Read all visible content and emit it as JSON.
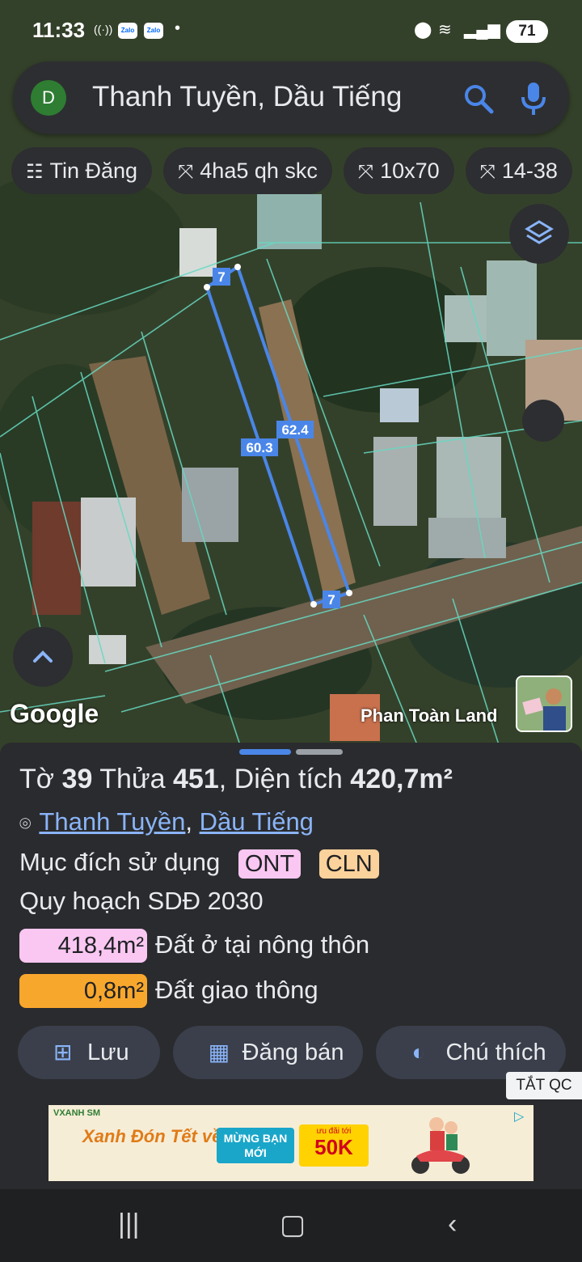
{
  "status_bar": {
    "time": "11:33",
    "battery": "71",
    "app_badges": [
      "Zalo",
      "Zalo"
    ]
  },
  "search": {
    "avatar_letter": "D",
    "query": "Thanh Tuyền, Dầu Tiếng"
  },
  "chips": [
    {
      "icon": "listing-icon",
      "label": "Tin Đăng"
    },
    {
      "icon": "measure-icon",
      "label": "4ha5 qh skc"
    },
    {
      "icon": "measure-icon",
      "label": "10x70"
    },
    {
      "icon": "measure-icon",
      "label": "14-38"
    }
  ],
  "map": {
    "side_labels": {
      "top": "7",
      "left": "60.3",
      "right": "62.4",
      "bottom": "7"
    },
    "attribution": "Phan Toàn Land",
    "logo": "Google"
  },
  "parcel": {
    "to_label": "Tờ",
    "to_value": "39",
    "thua_label": "Thửa",
    "thua_value": "451",
    "area_label": "Diện tích",
    "area_value": "420,7m²",
    "location_commune": "Thanh Tuyền",
    "location_district": "Dầu Tiếng",
    "purpose_label": "Mục đích sử dụng",
    "purpose_tags": [
      {
        "code": "ONT",
        "color": "#f9c7f2"
      },
      {
        "code": "CLN",
        "color": "#fbd29b"
      }
    ],
    "plan_title": "Quy hoạch SDĐ 2030",
    "land_uses": [
      {
        "area": "418,4m²",
        "label": "Đất ở tại nông thôn",
        "color": "#f9c7f2"
      },
      {
        "area": "0,8m²",
        "label": "Đất giao thông",
        "color": "#f8a72d"
      }
    ]
  },
  "actions": {
    "save": "Lưu",
    "post_sale": "Đăng bán",
    "legend": "Chú thích"
  },
  "ad": {
    "close_label": "TẮT QC",
    "brand": "VXANH SM",
    "slogan": "Xanh Đón Tết về",
    "box1": "MỪNG BẠN MỚI",
    "box2_small": "ưu đãi tới",
    "box2_big": "50K"
  }
}
